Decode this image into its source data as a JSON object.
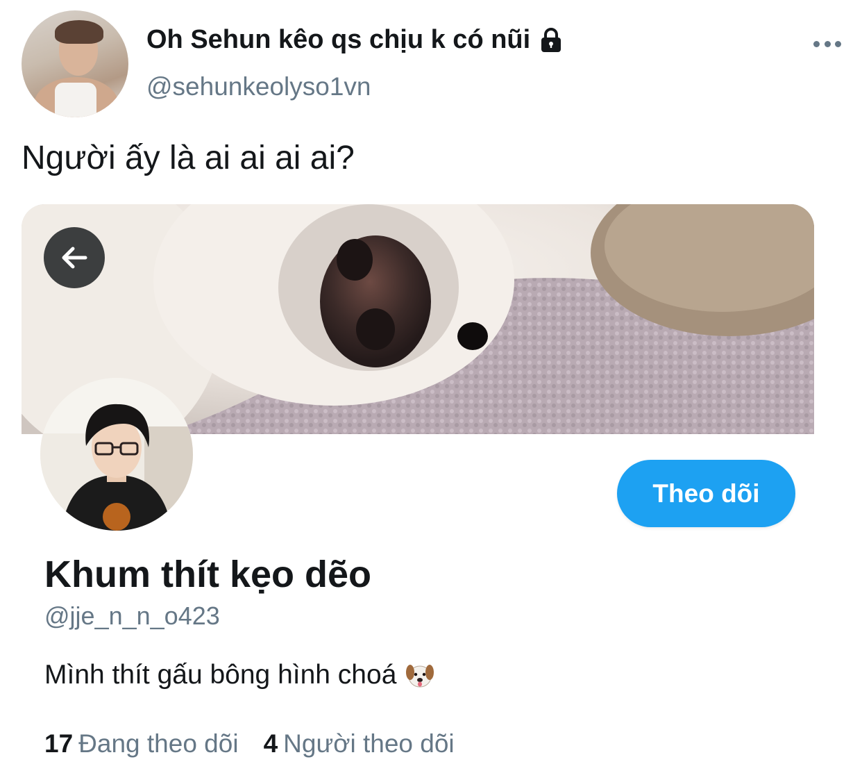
{
  "tweet": {
    "author_name": "Oh Sehun kêo qs chịu k có nũi",
    "author_handle": "@sehunkeolyso1vn",
    "text": "Người ấy là ai ai ai ai?",
    "lock_icon": "lock-icon",
    "more_icon": "more-icon"
  },
  "profile_card": {
    "back_icon": "arrow-left-icon",
    "follow_label": "Theo dõi",
    "name": "Khum thít kẹo dẽo",
    "handle": "@jje_n_n_o423",
    "bio": "Mình thít gấu bông hình choá",
    "bio_icon": "dog-face-icon",
    "stats": [
      {
        "count": "17",
        "label": "Đang theo dõi"
      },
      {
        "count": "4",
        "label": "Người theo dõi"
      }
    ]
  },
  "colors": {
    "accent": "#1da1f2",
    "secondary_text": "#657786",
    "primary_text": "#14171a"
  }
}
